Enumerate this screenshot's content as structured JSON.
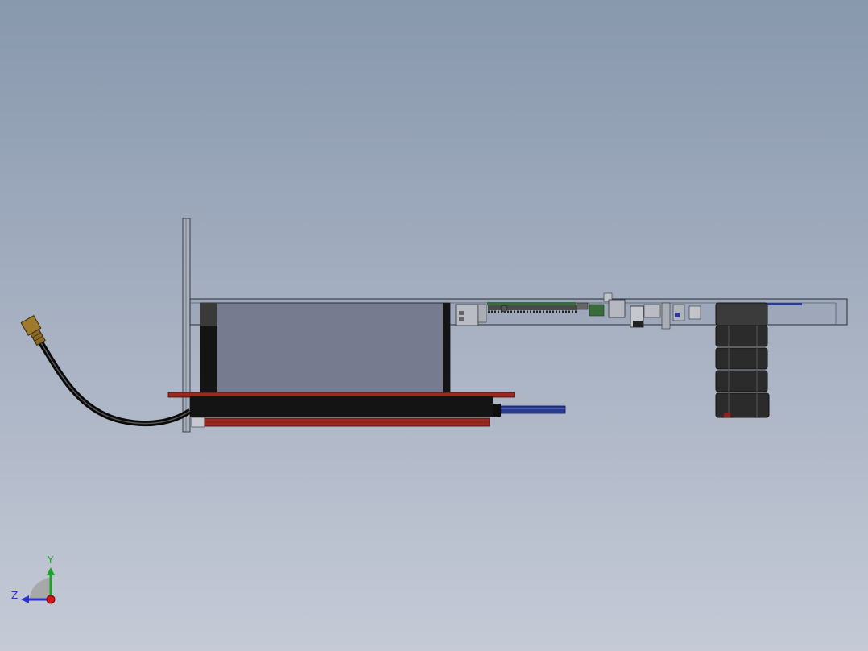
{
  "view": {
    "background_top": "#8898ad",
    "background_bottom": "#c5cad6"
  },
  "model": {
    "parts": [
      {
        "name": "connector",
        "color": "#a07a2c"
      },
      {
        "name": "cable",
        "color": "#151515"
      },
      {
        "name": "housing",
        "color": "#7a7d8e"
      },
      {
        "name": "heat-sink",
        "color": "#141414"
      },
      {
        "name": "pcb-frame",
        "color": "#9a2a20"
      },
      {
        "name": "blue-cable",
        "color": "#2a3b8f"
      },
      {
        "name": "board",
        "color": "#3a6b3a"
      },
      {
        "name": "inductor-stack",
        "color": "#2b2b2b"
      }
    ]
  },
  "triad": {
    "y_label": "Y",
    "z_label": "Z",
    "y_color": "#1fa02a",
    "z_color": "#2a33c8",
    "x_color": "#d01818"
  }
}
